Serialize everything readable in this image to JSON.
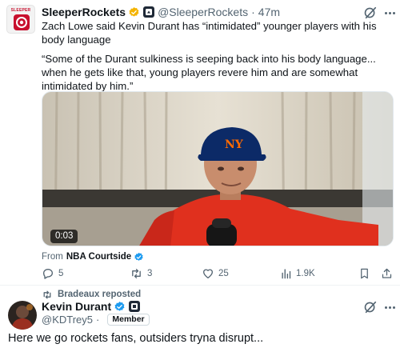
{
  "tweet": {
    "author_name": "SleeperRockets",
    "author_handle": "@SleeperRockets",
    "separator": "·",
    "time": "47m",
    "avatar_brand": "SLEEPER",
    "body": "Zach Lowe said Kevin Durant has “intimidated” younger players with his body language",
    "quote": "“Some of the Durant sulkiness is seeping back into his body language... when he gets like that, young players revere him and are somewhat intimidated by him.”",
    "video": {
      "duration": "0:03"
    },
    "source_prefix": "From",
    "source_name": "NBA Courtside",
    "counts": {
      "replies": "5",
      "reposts": "3",
      "likes": "25",
      "views": "1.9K"
    }
  },
  "repost_notice": "Bradeaux reposted",
  "reply": {
    "author_name": "Kevin Durant",
    "author_handle": "@KDTrey5",
    "separator": "·",
    "badge": "Member",
    "body": "Here we go rockets fans, outsiders tryna disrupt..."
  },
  "icons": {
    "verified": "verified-badge-icon",
    "affiliate": "affiliate-badge-icon",
    "grok": "grok-icon",
    "more": "more-icon",
    "reply": "reply-icon",
    "repost": "repost-icon",
    "like": "heart-icon",
    "views": "views-icon",
    "bookmark": "bookmark-icon",
    "share": "share-icon"
  },
  "colors": {
    "accent": "#1d9bf0",
    "text": "#0f1419",
    "muted": "#536471",
    "brand_red": "#c8102e"
  }
}
